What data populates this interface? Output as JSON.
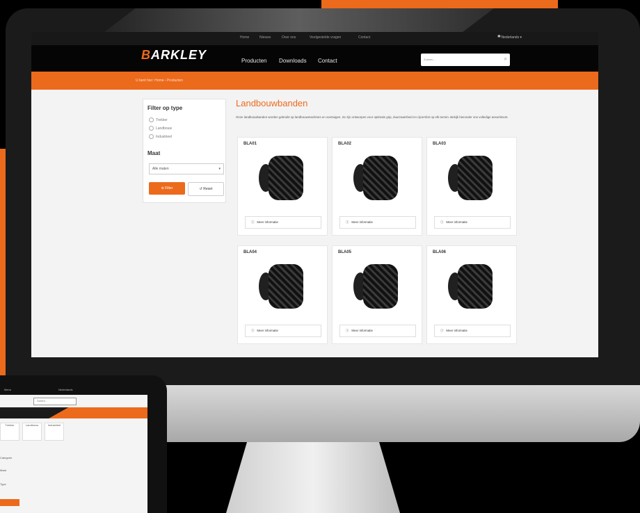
{
  "colors": {
    "accent": "#ec6a1c",
    "dark": "#050505"
  },
  "topbar": {
    "links": [
      "Home",
      "Nieuws",
      "Over ons",
      "Veelgestelde vragen",
      "Contact"
    ],
    "language": "Nederlands"
  },
  "header": {
    "logo_text": "ARKLEY",
    "logo_mark": "B",
    "nav": [
      "Producten",
      "Downloads",
      "Contact"
    ],
    "search_placeholder": "Zoeken...",
    "search_icon": "search-icon"
  },
  "breadcrumb": "U bent hier: Home › Producten",
  "filter": {
    "title": "Filter op type",
    "options": [
      "Trekker",
      "Landbouw",
      "Industrieel"
    ],
    "size_title": "Maat",
    "size_value": "Alle maten",
    "filter_button": "Filter",
    "reset_button": "Reset"
  },
  "main": {
    "heading": "Landbouwbanden",
    "intro": "Onze landbouwbanden worden gebruikt op landbouwmachines en voertuigen. Ze zijn ontworpen voor optimale grip, duurzaamheid en rijcomfort op elk terrein. Bekijk hieronder ons volledige assortiment."
  },
  "products": [
    {
      "name": "BLA01",
      "more": "Meer informatie"
    },
    {
      "name": "BLA02",
      "more": "Meer informatie"
    },
    {
      "name": "BLA03",
      "more": "Meer informatie"
    },
    {
      "name": "BLA04",
      "more": "Meer informatie"
    },
    {
      "name": "BLA05",
      "more": "Meer informatie"
    },
    {
      "name": "BLA06",
      "more": "Meer informatie"
    }
  ],
  "tablet": {
    "top_left": "Menu",
    "top_right": "Nederlands",
    "search_placeholder": "Zoeken...",
    "tiles": [
      "Trekker",
      "Landbouw",
      "Industrieel"
    ],
    "rows": [
      "Categorie",
      "Maat",
      "Type"
    ]
  }
}
